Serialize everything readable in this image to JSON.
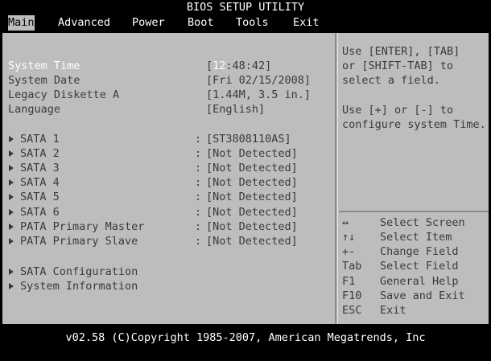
{
  "title": "BIOS SETUP UTILITY",
  "menu": {
    "items": [
      {
        "label": "Main"
      },
      {
        "label": "Advanced"
      },
      {
        "label": "Power"
      },
      {
        "label": "Boot"
      },
      {
        "label": "Tools"
      },
      {
        "label": "Exit"
      }
    ]
  },
  "main": {
    "system_time": {
      "label": "System Time",
      "value_bracket_open": "[",
      "value_hour": "12",
      "value_rest": ":48:42]"
    },
    "system_date": {
      "label": "System Date",
      "value": "[Fri 02/15/2008]"
    },
    "legacy_diskette": {
      "label": "Legacy Diskette A",
      "value": "[1.44M, 3.5 in.]"
    },
    "language": {
      "label": "Language",
      "value": "[English]"
    },
    "drives": [
      {
        "label": "SATA 1",
        "colon": ":",
        "value": "[ST3808110AS]"
      },
      {
        "label": "SATA 2",
        "colon": ":",
        "value": "[Not Detected]"
      },
      {
        "label": "SATA 3",
        "colon": ":",
        "value": "[Not Detected]"
      },
      {
        "label": "SATA 4",
        "colon": ":",
        "value": "[Not Detected]"
      },
      {
        "label": "SATA 5",
        "colon": ":",
        "value": "[Not Detected]"
      },
      {
        "label": "SATA 6",
        "colon": ":",
        "value": "[Not Detected]"
      },
      {
        "label": "PATA Primary Master",
        "colon": ":",
        "value": "[Not Detected]"
      },
      {
        "label": "PATA Primary Slave",
        "colon": ":",
        "value": "[Not Detected]"
      }
    ],
    "submenus": [
      {
        "label": "SATA Configuration"
      },
      {
        "label": "System Information"
      }
    ]
  },
  "help": {
    "text1": "Use [ENTER], [TAB]\nor [SHIFT-TAB] to\nselect a field.",
    "text2": "Use [+] or [-] to\nconfigure system Time.",
    "keys": [
      {
        "key": "↔",
        "desc": "Select Screen"
      },
      {
        "key": "↑↓",
        "desc": "Select Item"
      },
      {
        "key": "+-",
        "desc": "Change Field"
      },
      {
        "key": "Tab",
        "desc": "Select Field"
      },
      {
        "key": "F1",
        "desc": "General Help"
      },
      {
        "key": "F10",
        "desc": "Save and Exit"
      },
      {
        "key": "ESC",
        "desc": "Exit"
      }
    ]
  },
  "footer": "v02.58 (C)Copyright 1985-2007, American Megatrends, Inc"
}
